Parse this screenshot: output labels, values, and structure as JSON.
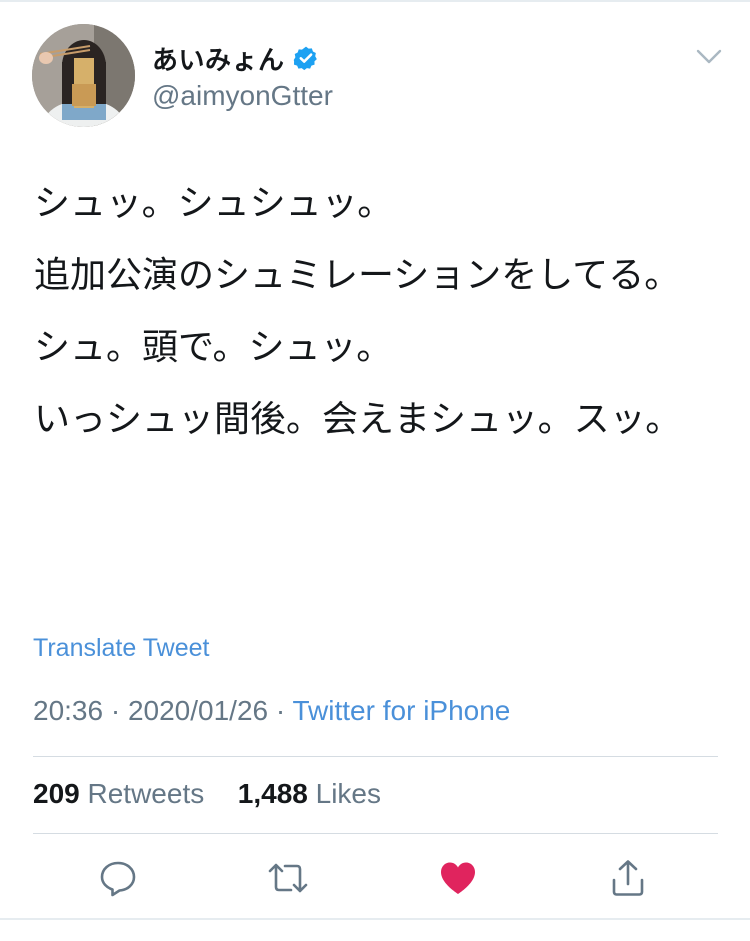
{
  "tweet": {
    "author": {
      "display_name": "あいみょん",
      "handle": "@aimyonGtter",
      "verified": true
    },
    "body_paragraphs": [
      "シュッ。シュシュッ。",
      "追加公演のシュミレーションをしてる。",
      "シュ。頭で。シュッ。",
      "いっシュッ間後。会えまシュッ。スッ。"
    ],
    "translate_label": "Translate Tweet",
    "time": "20:36",
    "date": "2020/01/26",
    "separator": "·",
    "source": "Twitter for iPhone",
    "stats": {
      "retweets_count": "209",
      "retweets_label": "Retweets",
      "likes_count": "1,488",
      "likes_label": "Likes"
    },
    "liked": true
  },
  "icons": [
    "chevron-down-icon",
    "verified-badge-icon",
    "reply-icon",
    "retweet-icon",
    "heart-icon",
    "share-icon"
  ],
  "colors": {
    "link_blue": "#4a90d9",
    "verified_blue": "#1da1f2",
    "heart_red": "#e0245e",
    "secondary_text": "#657786",
    "primary_text": "#14171a",
    "icon_gray": "#657786"
  }
}
